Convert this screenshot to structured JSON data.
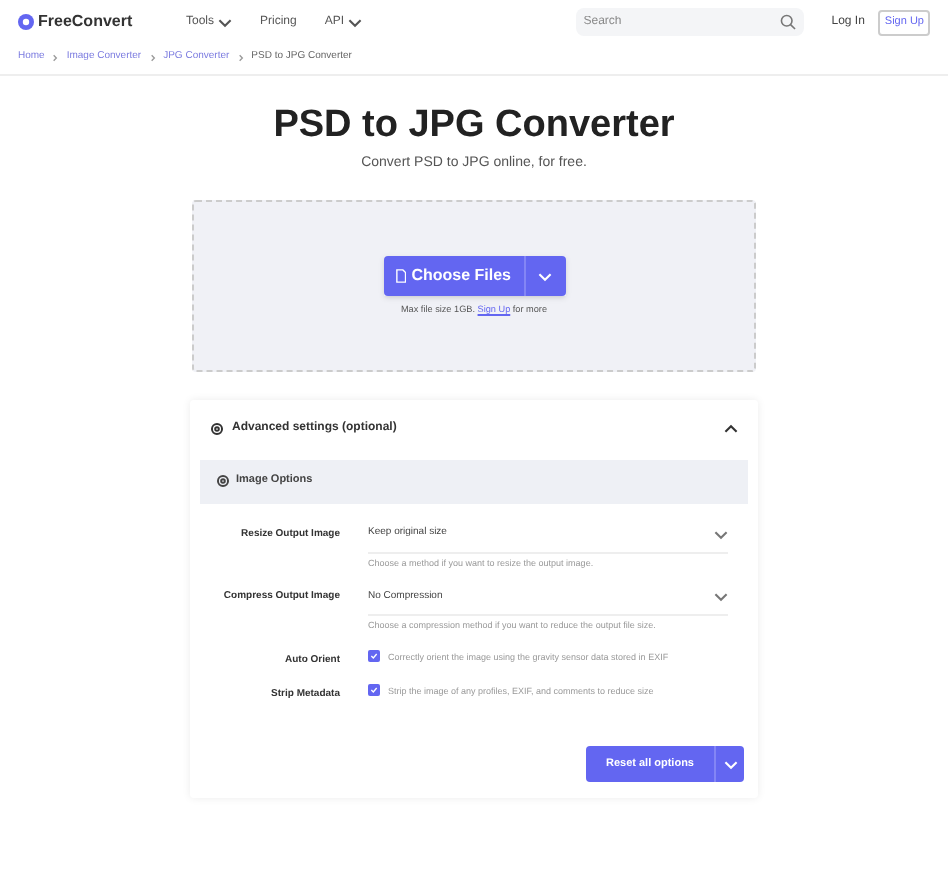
{
  "header": {
    "logo": "FreeConvert",
    "nav": [
      {
        "label": "Tools",
        "dropdown": true
      },
      {
        "label": "Pricing",
        "dropdown": false
      },
      {
        "label": "API",
        "dropdown": true
      }
    ],
    "search": {
      "placeholder": "Search"
    },
    "login": "Log In",
    "signup": "Sign Up"
  },
  "breadcrumb": [
    "Home",
    "Image Converter",
    "JPG Converter",
    "PSD to JPG Converter"
  ],
  "title": "PSD to JPG Converter",
  "subtitle": "Convert PSD to JPG online, for free.",
  "upload": {
    "button": "Choose Files",
    "note_before": "Max file size 1GB.",
    "note_link": "Sign Up",
    "note_after": "for more"
  },
  "advanced": {
    "title": "Advanced settings (optional)",
    "expanded": true,
    "section": "Image Options",
    "options": [
      {
        "kind": "select",
        "label": "Resize Output Image",
        "value": "Keep original size",
        "hint": "Choose a method if you want to resize the output image."
      },
      {
        "kind": "select",
        "label": "Compress Output Image",
        "value": "No Compression",
        "hint": "Choose a compression method if you want to reduce the output file size."
      },
      {
        "kind": "checkbox",
        "label": "Auto Orient",
        "checked": true,
        "hint": "Correctly orient the image using the gravity sensor data stored in EXIF"
      },
      {
        "kind": "checkbox",
        "label": "Strip Metadata",
        "checked": true,
        "hint": "Strip the image of any profiles, EXIF, and comments to reduce size"
      }
    ],
    "reset": "Reset all options"
  }
}
